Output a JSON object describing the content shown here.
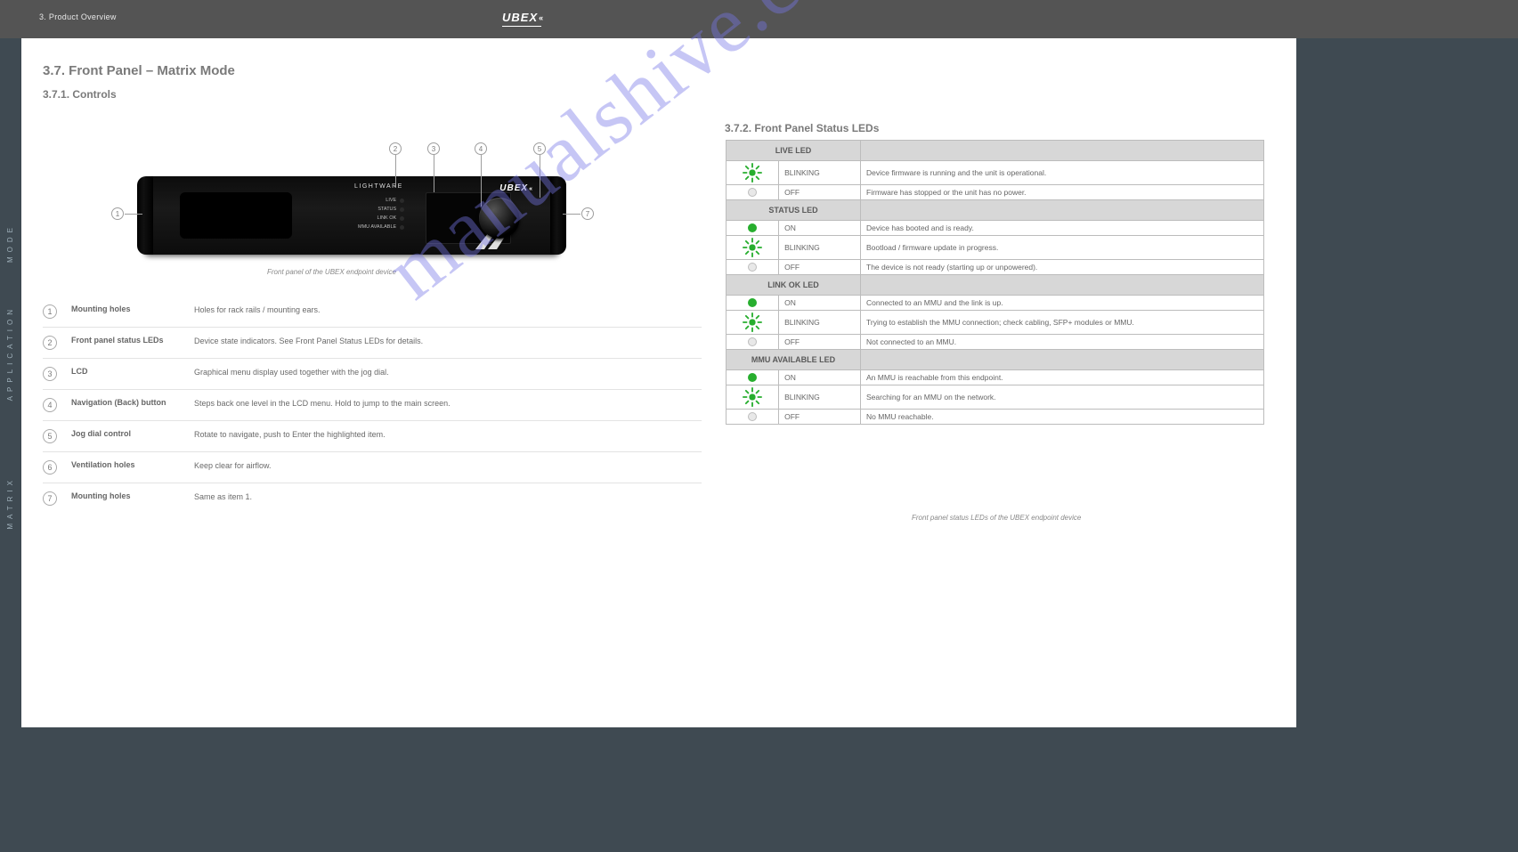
{
  "topbar": {
    "section": "3. Product Overview",
    "logo": "UBEX"
  },
  "sidebar": {
    "top": "MODE",
    "mid": "APPLICATION",
    "bot": "MATRIX"
  },
  "page": {
    "h1": "3.7. Front Panel – Matrix Mode",
    "h2": "3.7.1. Controls",
    "caption_device": "Front panel of the UBEX endpoint device",
    "numbers": {
      "1": "1",
      "2": "2",
      "3": "3",
      "4": "4",
      "5": "5",
      "6": "6",
      "7": "7"
    }
  },
  "ref": [
    {
      "n": "1",
      "name": "Mounting holes",
      "desc": "Holes for rack rails / mounting ears."
    },
    {
      "n": "2",
      "name": "Front panel status LEDs",
      "desc": "Device state indicators. See Front Panel Status LEDs for details."
    },
    {
      "n": "3",
      "name": "LCD",
      "desc": "Graphical menu display used together with the jog dial."
    },
    {
      "n": "4",
      "name": "Navigation (Back) button",
      "desc": "Steps back one level in the LCD menu. Hold to jump to the main screen."
    },
    {
      "n": "5",
      "name": "Jog dial control",
      "desc": "Rotate to navigate, push to Enter the highlighted item."
    },
    {
      "n": "6",
      "name": "Ventilation holes",
      "desc": "Keep clear for airflow."
    },
    {
      "n": "7",
      "name": "Mounting holes",
      "desc": "Same as item 1."
    }
  ],
  "right_title": "3.7.2. Front Panel Status LEDs",
  "led_caption": "Front panel status LEDs of the UBEX endpoint device",
  "sections": [
    {
      "label": "LIVE LED",
      "rows": [
        {
          "icon": "blink",
          "state": "BLINKING",
          "desc": "Device firmware is running and the unit is operational."
        },
        {
          "icon": "off",
          "state": "OFF",
          "desc": "Firmware has stopped or the unit has no power."
        }
      ]
    },
    {
      "label": "STATUS LED",
      "rows": [
        {
          "icon": "on",
          "state": "ON",
          "desc": "Device has booted and is ready."
        },
        {
          "icon": "blink",
          "state": "BLINKING",
          "desc": "Bootload / firmware update in progress."
        },
        {
          "icon": "off",
          "state": "OFF",
          "desc": "The device is not ready (starting up or unpowered)."
        }
      ]
    },
    {
      "label": "LINK OK LED",
      "rows": [
        {
          "icon": "on",
          "state": "ON",
          "desc": "Connected to an MMU and the link is up."
        },
        {
          "icon": "blink",
          "state": "BLINKING",
          "desc": "Trying to establish the MMU connection; check cabling, SFP+ modules or MMU."
        },
        {
          "icon": "off",
          "state": "OFF",
          "desc": "Not connected to an MMU."
        }
      ]
    },
    {
      "label": "MMU AVAILABLE LED",
      "rows": [
        {
          "icon": "on",
          "state": "ON",
          "desc": "An MMU is reachable from this endpoint."
        },
        {
          "icon": "blink",
          "state": "BLINKING",
          "desc": "Searching for an MMU on the network."
        },
        {
          "icon": "off",
          "state": "OFF",
          "desc": "No MMU reachable."
        }
      ]
    }
  ],
  "device": {
    "brand_left": "LIGHTWARE",
    "brand_right": "UBEX",
    "leds": [
      "LIVE",
      "STATUS",
      "LINK OK",
      "MMU AVAILABLE"
    ]
  },
  "watermark": "manualshive.com"
}
